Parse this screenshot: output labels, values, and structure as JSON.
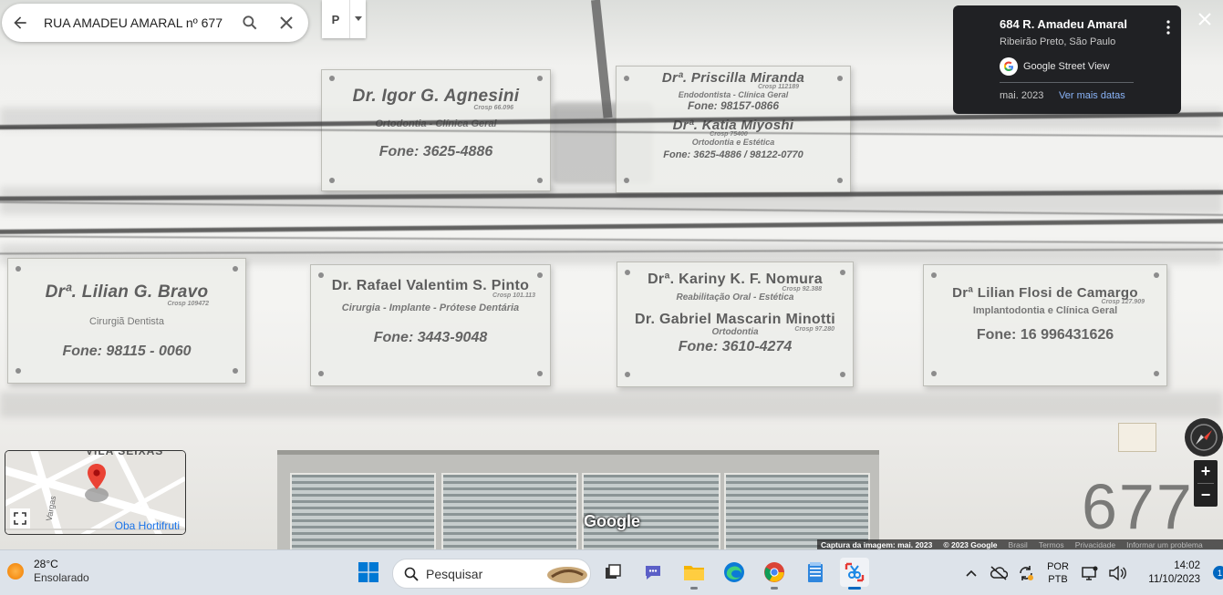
{
  "search": {
    "query": "RUA AMADEU AMARAL nº 677"
  },
  "pegman": {
    "label": "P"
  },
  "info_card": {
    "title": "684 R. Amadeu Amaral",
    "subtitle": "Ribeirão Preto, São Paulo",
    "brand": "Google Street View",
    "date": "mai. 2023",
    "more_dates": "Ver mais datas"
  },
  "plaques": [
    {
      "name": "Dr. Igor G. Agnesini",
      "cro": "Crosp 66.096",
      "spec": "Ortodontia - Clínica Geral",
      "phone": "Fone: 3625-4886"
    },
    {
      "name": "Drª. Priscilla Miranda",
      "cro": "Crosp 112189",
      "spec": "Endodontista - Clínica Geral",
      "phone": "Fone: 98157-0866",
      "name2": "Drª. Katia Miyoshi",
      "cro2": "Crosp 75400",
      "spec2": "Ortodontia e Estética",
      "phone2": "Fone: 3625-4886 / 98122-0770"
    },
    {
      "name": "Drª. Lilian G. Bravo",
      "cro": "Crosp 109472",
      "spec": "Cirurgiã Dentista",
      "phone": "Fone: 98115 - 0060"
    },
    {
      "name": "Dr. Rafael Valentim S. Pinto",
      "cro": "Crosp 101.113",
      "spec": "Cirurgia - Implante - Prótese Dentária",
      "phone": "Fone: 3443-9048"
    },
    {
      "name": "Drª. Kariny K. F. Nomura",
      "cro": "Crosp 92.388",
      "spec": "Reabilitação Oral - Estética",
      "name2": "Dr. Gabriel Mascarin Minotti",
      "cro2": "Crosp 97.280",
      "spec2": "Ortodontia",
      "phone2": "Fone: 3610-4274"
    },
    {
      "name": "Drª Lilian Flosi de Camargo",
      "cro": "Crosp 127.909",
      "spec": "Implantodontia e Clínica Geral",
      "phone": "Fone: 16 996431626"
    }
  ],
  "scene": {
    "house_number": "677",
    "watermark": "Google"
  },
  "minimap": {
    "top_label": "VILA SEIXAS",
    "street": "Vargas",
    "poi": "Oba Hortifruti"
  },
  "attribution": {
    "capture": "Captura da imagem: mai. 2023",
    "copyright": "© 2023 Google",
    "links": [
      "Brasil",
      "Termos",
      "Privacidade",
      "Informar um problema"
    ]
  },
  "taskbar": {
    "weather_temp": "28°C",
    "weather_desc": "Ensolarado",
    "search_placeholder": "Pesquisar",
    "lang_1": "POR",
    "lang_2": "PTB",
    "time": "14:02",
    "date": "11/10/2023",
    "notifications": "1"
  },
  "colors": {
    "card_bg": "#202124",
    "link": "#8ab4f8",
    "windows_blue": "#0067c0"
  }
}
